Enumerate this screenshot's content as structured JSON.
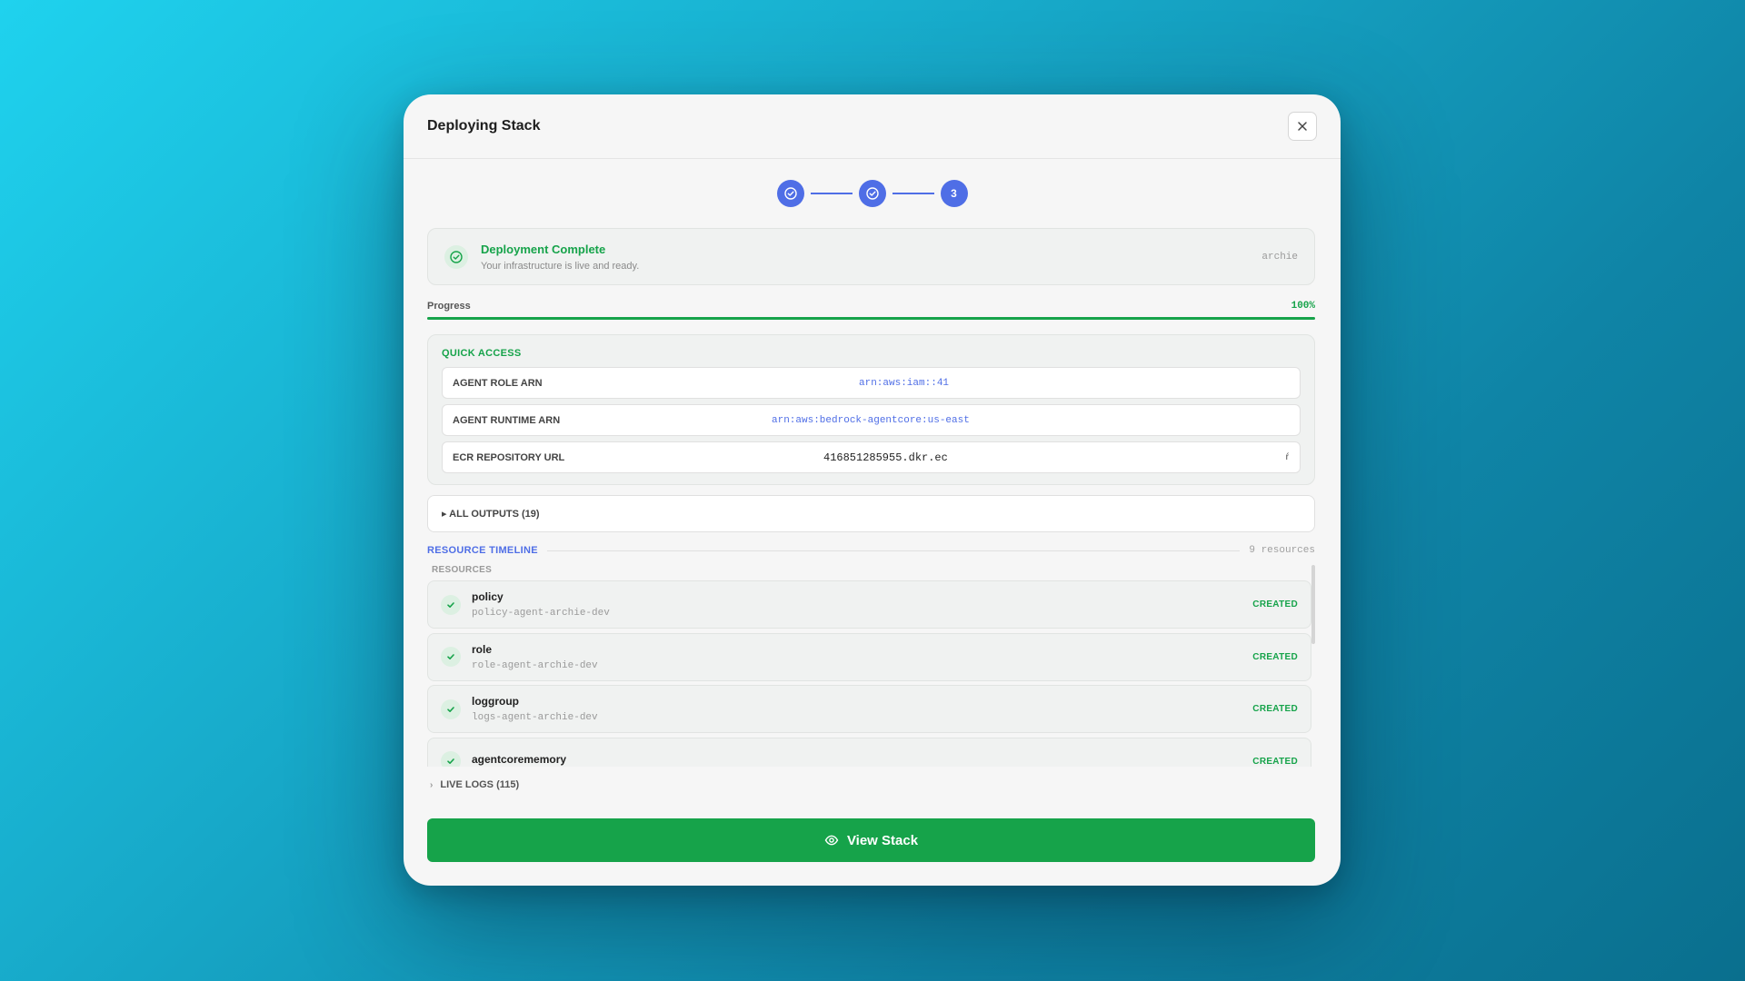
{
  "modal": {
    "title": "Deploying Stack"
  },
  "stepper": {
    "step3_label": "3"
  },
  "status": {
    "title": "Deployment Complete",
    "subtitle": "Your infrastructure is live and ready.",
    "user": "archie"
  },
  "progress": {
    "label": "Progress",
    "value_text": "100%",
    "fraction": 1.0
  },
  "quick_access": {
    "title": "QUICK ACCESS",
    "rows": [
      {
        "label": "AGENT ROLE ARN",
        "value": "arn:aws:iam::41"
      },
      {
        "label": "AGENT RUNTIME ARN",
        "value": "arn:aws:bedrock-agentcore:us-east"
      },
      {
        "label": "ECR REPOSITORY URL",
        "value": "416851285955.dkr.ec",
        "tail": "ŕ"
      }
    ]
  },
  "outputs": {
    "label": "▸ ALL OUTPUTS (19)"
  },
  "timeline": {
    "title": "RESOURCE TIMELINE",
    "count": "9 resources",
    "caption": "RESOURCES",
    "resources": [
      {
        "name": "policy",
        "id": "policy-agent-archie-dev",
        "status": "CREATED"
      },
      {
        "name": "role",
        "id": "role-agent-archie-dev",
        "status": "CREATED"
      },
      {
        "name": "loggroup",
        "id": "logs-agent-archie-dev",
        "status": "CREATED"
      },
      {
        "name": "agentcorememory",
        "id": "",
        "status": "CREATED"
      }
    ]
  },
  "live_logs": {
    "label": "LIVE LOGS (115)"
  },
  "view_button": {
    "label": "View Stack"
  },
  "colors": {
    "accent_blue": "#4f6ee6",
    "success_green": "#16a34a"
  }
}
